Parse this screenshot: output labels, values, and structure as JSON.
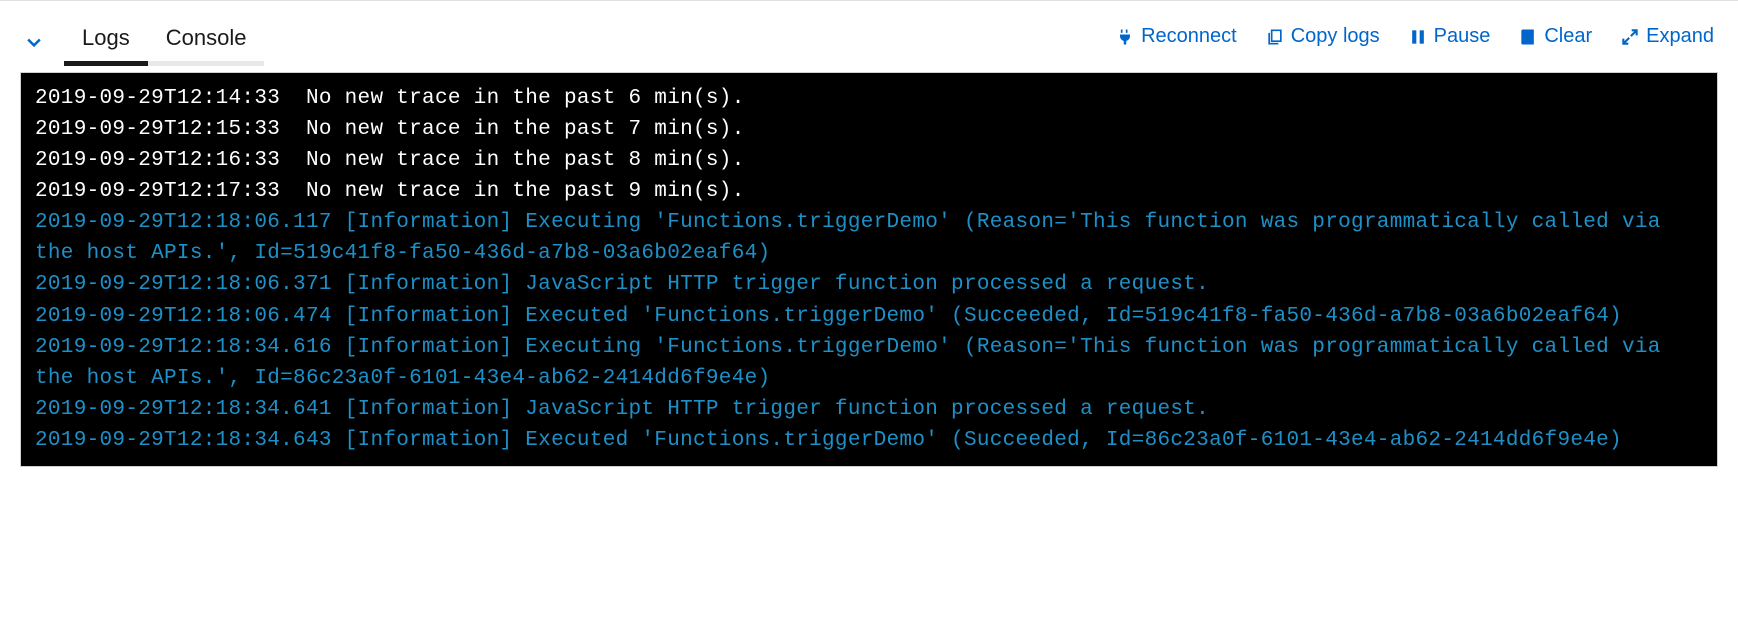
{
  "tabs": {
    "logs": "Logs",
    "console": "Console"
  },
  "actions": {
    "reconnect": "Reconnect",
    "copyLogs": "Copy logs",
    "pause": "Pause",
    "clear": "Clear",
    "expand": "Expand"
  },
  "logs": [
    {
      "cls": "white",
      "text": "2019-09-29T12:14:33  No new trace in the past 6 min(s)."
    },
    {
      "cls": "white",
      "text": "2019-09-29T12:15:33  No new trace in the past 7 min(s)."
    },
    {
      "cls": "white",
      "text": "2019-09-29T12:16:33  No new trace in the past 8 min(s)."
    },
    {
      "cls": "white",
      "text": "2019-09-29T12:17:33  No new trace in the past 9 min(s)."
    },
    {
      "cls": "info",
      "text": "2019-09-29T12:18:06.117 [Information] Executing 'Functions.triggerDemo' (Reason='This function was programmatically called via the host APIs.', Id=519c41f8-fa50-436d-a7b8-03a6b02eaf64)"
    },
    {
      "cls": "info",
      "text": "2019-09-29T12:18:06.371 [Information] JavaScript HTTP trigger function processed a request."
    },
    {
      "cls": "info",
      "text": "2019-09-29T12:18:06.474 [Information] Executed 'Functions.triggerDemo' (Succeeded, Id=519c41f8-fa50-436d-a7b8-03a6b02eaf64)"
    },
    {
      "cls": "info",
      "text": "2019-09-29T12:18:34.616 [Information] Executing 'Functions.triggerDemo' (Reason='This function was programmatically called via the host APIs.', Id=86c23a0f-6101-43e4-ab62-2414dd6f9e4e)"
    },
    {
      "cls": "info",
      "text": "2019-09-29T12:18:34.641 [Information] JavaScript HTTP trigger function processed a request."
    },
    {
      "cls": "info",
      "text": "2019-09-29T12:18:34.643 [Information] Executed 'Functions.triggerDemo' (Succeeded, Id=86c23a0f-6101-43e4-ab62-2414dd6f9e4e)"
    }
  ]
}
